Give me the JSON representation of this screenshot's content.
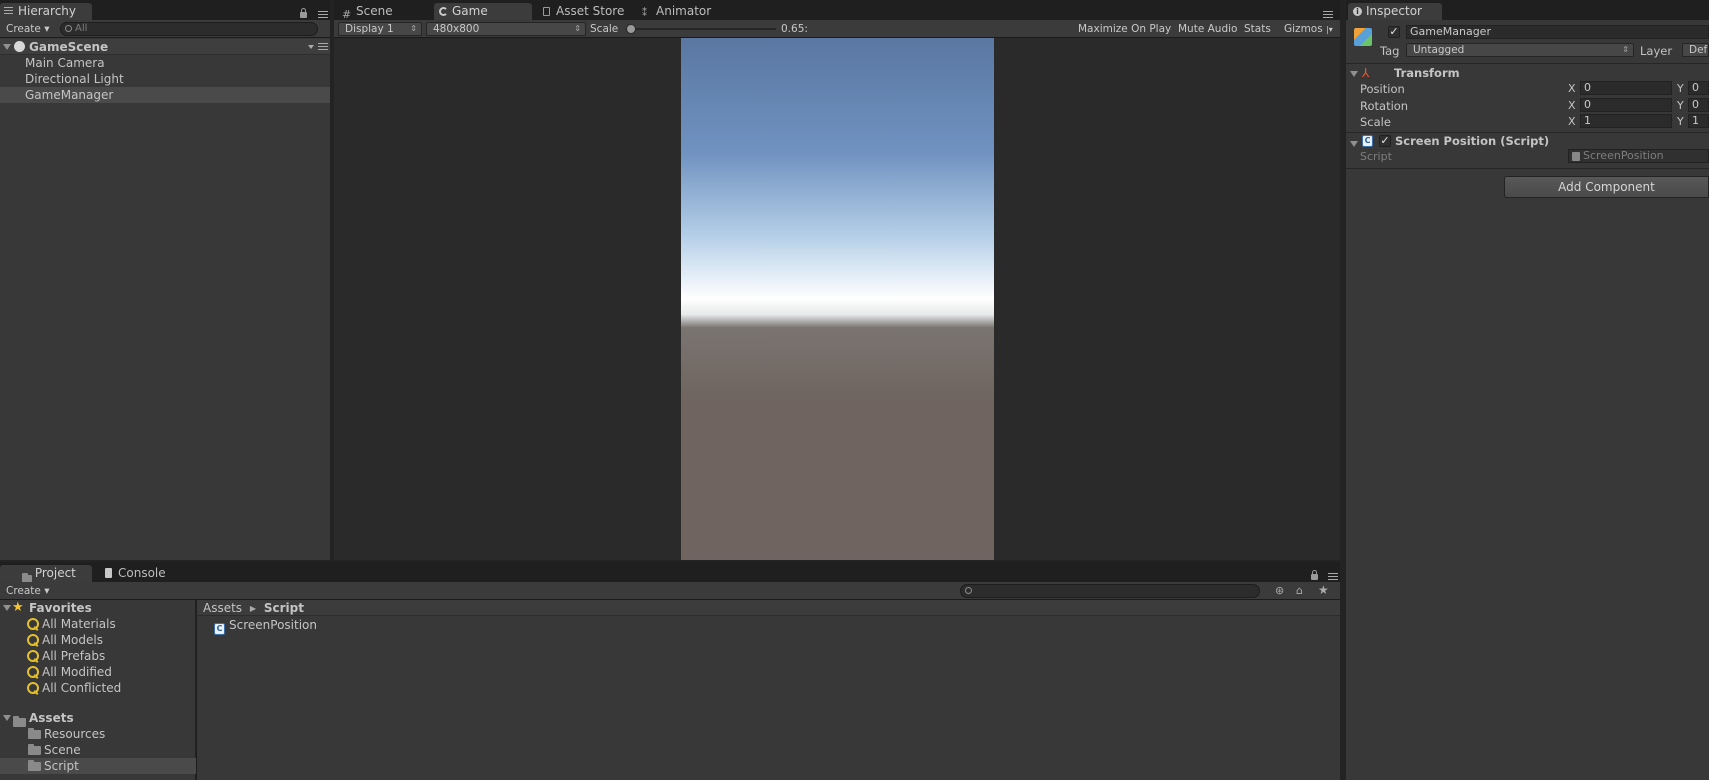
{
  "hierarchy": {
    "tab_label": "Hierarchy",
    "create_label": "Create",
    "search_placeholder": "All",
    "scene_name": "GameScene",
    "items": [
      {
        "label": "Main Camera"
      },
      {
        "label": "Directional Light"
      },
      {
        "label": "GameManager"
      }
    ]
  },
  "center_tabs": [
    {
      "label": "Scene"
    },
    {
      "label": "Game"
    },
    {
      "label": "Asset Store"
    },
    {
      "label": "Animator"
    }
  ],
  "game_toolbar": {
    "display": "Display 1",
    "resolution": "480x800",
    "scale_label": "Scale",
    "scale_value": "0.65:",
    "scale_fraction": 0.0,
    "maximize": "Maximize On Play",
    "mute": "Mute Audio",
    "stats": "Stats",
    "gizmos": "Gizmos"
  },
  "inspector": {
    "tab_label": "Inspector",
    "object_name": "GameManager",
    "tag_label": "Tag",
    "tag_value": "Untagged",
    "layer_label": "Layer",
    "layer_value": "Defa",
    "transform": {
      "title": "Transform",
      "rows": [
        {
          "label": "Position",
          "x_label": "X",
          "x": "0",
          "y_label": "Y",
          "y": "0"
        },
        {
          "label": "Rotation",
          "x_label": "X",
          "x": "0",
          "y_label": "Y",
          "y": "0"
        },
        {
          "label": "Scale",
          "x_label": "X",
          "x": "1",
          "y_label": "Y",
          "y": "1"
        }
      ]
    },
    "script_component": {
      "title": "Screen Position (Script)",
      "script_label": "Script",
      "script_value": "ScreenPosition"
    },
    "add_component": "Add Component"
  },
  "project": {
    "tab_label": "Project",
    "console_label": "Console",
    "create_label": "Create",
    "favorites_label": "Favorites",
    "favorites": [
      {
        "label": "All Materials"
      },
      {
        "label": "All Models"
      },
      {
        "label": "All Prefabs"
      },
      {
        "label": "All Modified"
      },
      {
        "label": "All Conflicted"
      }
    ],
    "assets_label": "Assets",
    "folders": [
      {
        "label": "Resources"
      },
      {
        "label": "Scene"
      },
      {
        "label": "Script"
      }
    ],
    "breadcrumb": [
      "Assets",
      "Script"
    ],
    "files": [
      {
        "label": "ScreenPosition"
      }
    ]
  },
  "colors": {
    "panel": "#383838",
    "selected_row": "#4a4a4a",
    "sky_top": "#5a77a2",
    "horizon": "#ffffff",
    "ground": "#6f645f"
  }
}
